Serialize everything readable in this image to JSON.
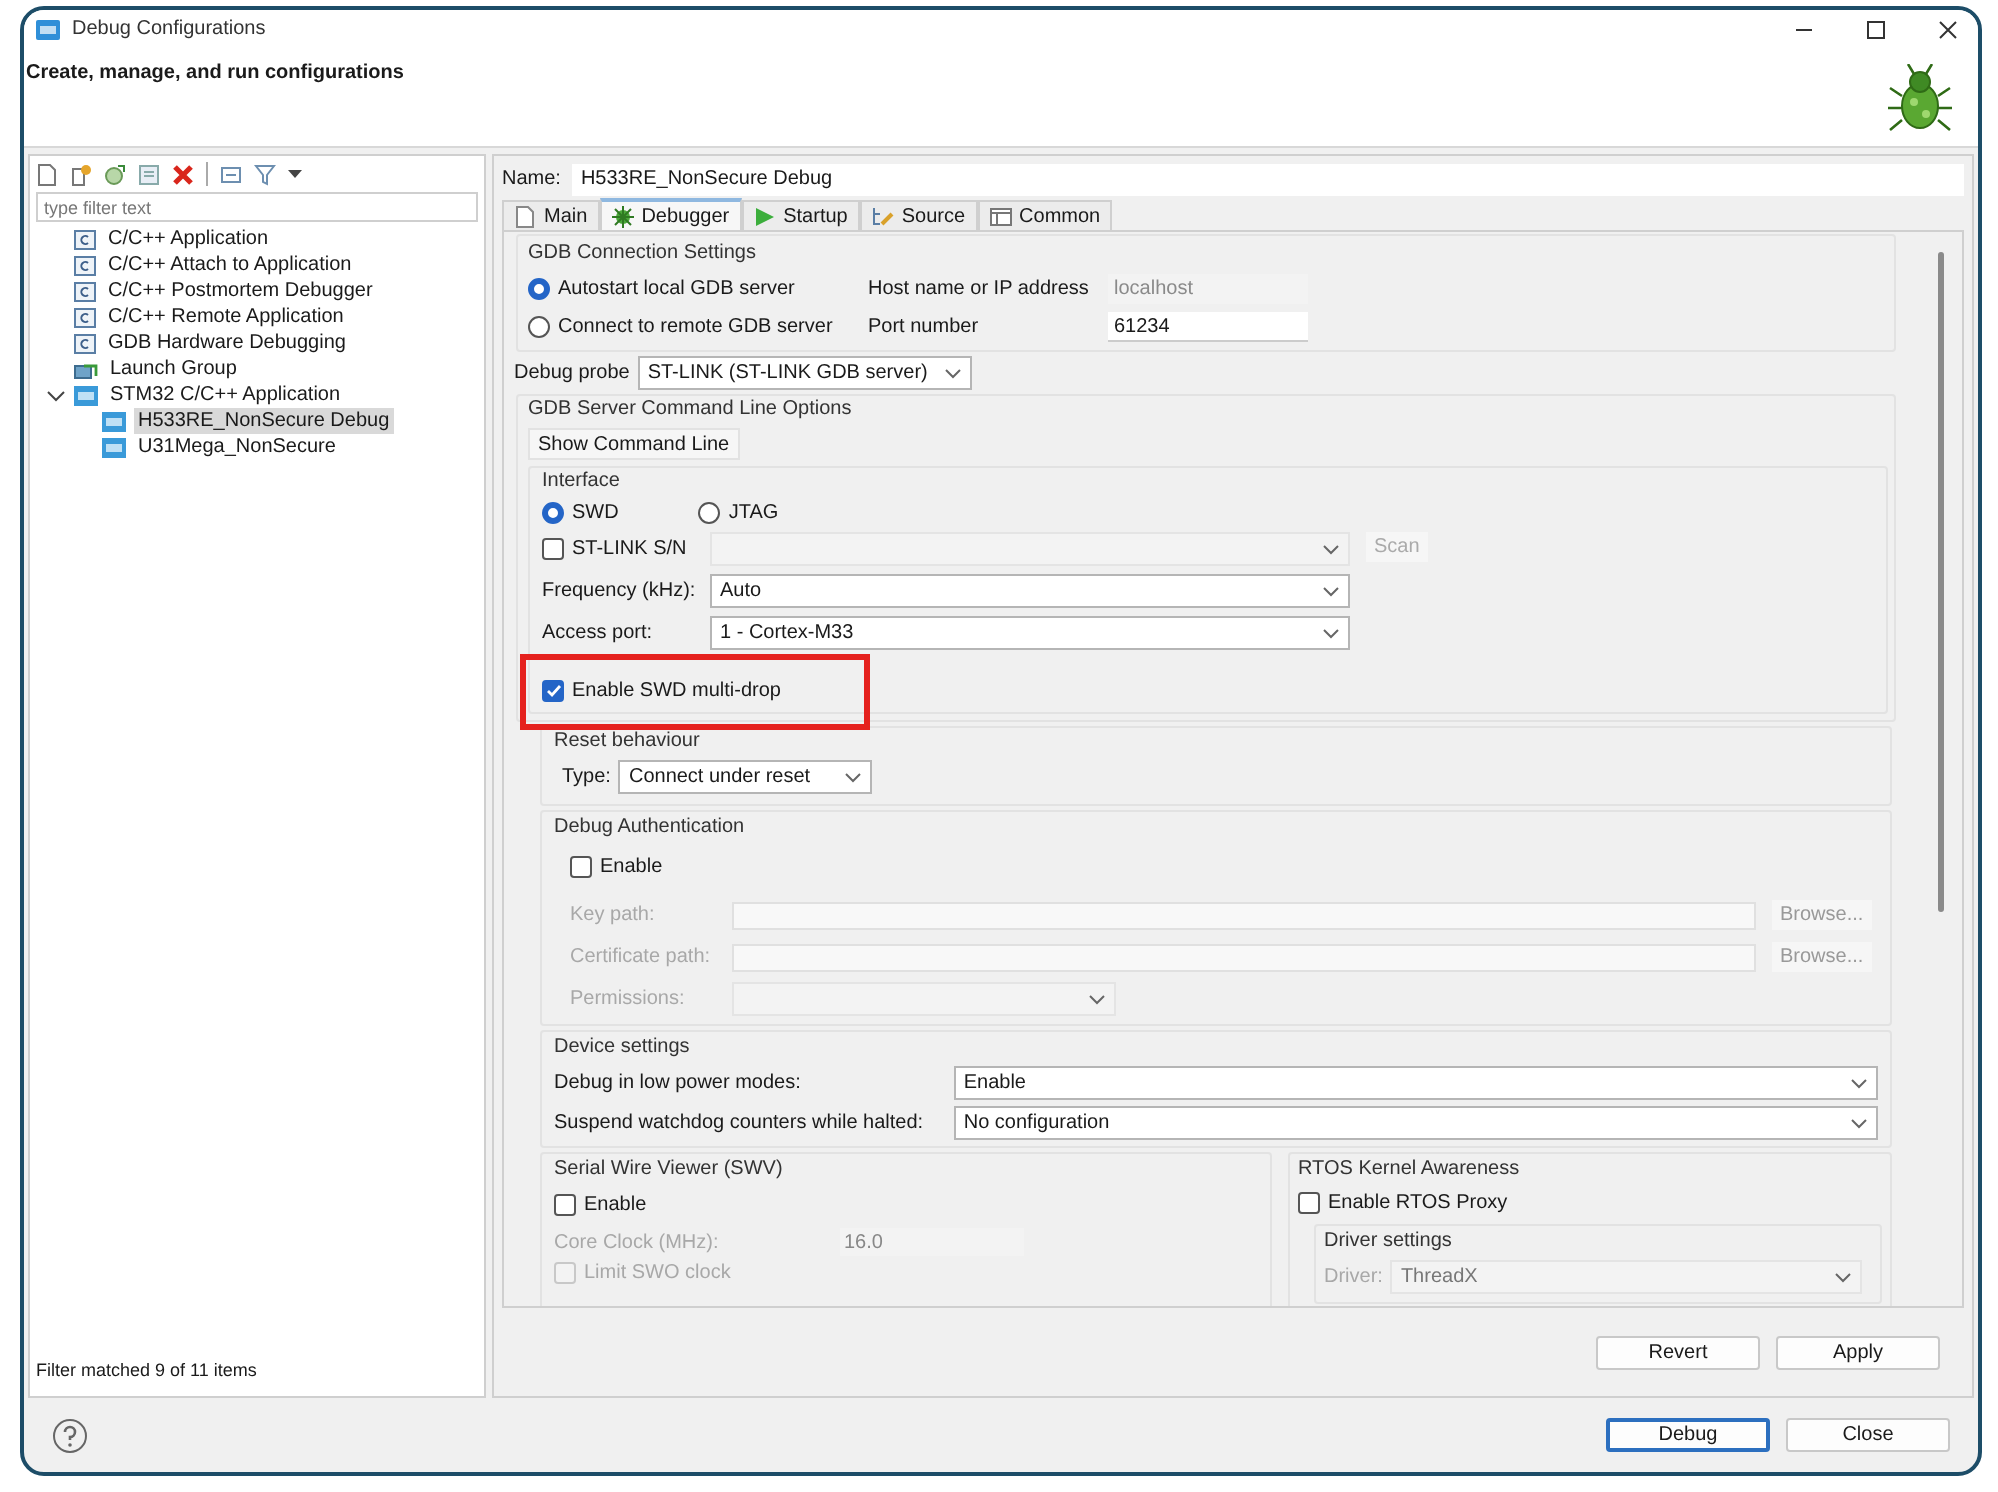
{
  "window": {
    "title": "Debug Configurations"
  },
  "header": {
    "title": "Create, manage, and run configurations"
  },
  "sidebar": {
    "filter": {
      "placeholder": "type filter text"
    },
    "tree": [
      {
        "label": "C/C++ Application",
        "kind": "c",
        "selected": false
      },
      {
        "label": "C/C++ Attach to Application",
        "kind": "c",
        "selected": false
      },
      {
        "label": "C/C++ Postmortem Debugger",
        "kind": "c",
        "selected": false
      },
      {
        "label": "C/C++ Remote Application",
        "kind": "c",
        "selected": false
      },
      {
        "label": "GDB Hardware Debugging",
        "kind": "c",
        "selected": false
      },
      {
        "label": "Launch Group",
        "kind": "launch",
        "selected": false
      },
      {
        "label": "STM32 C/C++ Application",
        "kind": "ide",
        "selected": false,
        "expanded": true,
        "children": [
          {
            "label": "H533RE_NonSecure Debug",
            "kind": "ide",
            "selected": true
          },
          {
            "label": "U31Mega_NonSecure",
            "kind": "ide",
            "selected": false
          }
        ]
      }
    ],
    "status": "Filter matched 9 of 11 items"
  },
  "editor": {
    "name_label": "Name:",
    "name_value": "H533RE_NonSecure Debug",
    "tabs": [
      {
        "label": "Main",
        "kind": "main",
        "selected": false
      },
      {
        "label": "Debugger",
        "kind": "debugger",
        "selected": true
      },
      {
        "label": "Startup",
        "kind": "startup",
        "selected": false
      },
      {
        "label": "Source",
        "kind": "source",
        "selected": false
      },
      {
        "label": "Common",
        "kind": "common",
        "selected": false
      }
    ],
    "gdb_connection": {
      "title": "GDB Connection Settings",
      "options": [
        {
          "label": "Autostart local GDB server",
          "selected": true
        },
        {
          "label": "Connect to remote GDB server",
          "selected": false
        }
      ],
      "host": {
        "label": "Host name or IP address",
        "value": "localhost",
        "disabled": true
      },
      "port": {
        "label": "Port number",
        "value": "61234",
        "disabled": false
      }
    },
    "debug_probe": {
      "label": "Debug probe",
      "value": "ST-LINK (ST-LINK GDB server)"
    },
    "server_options": {
      "title": "GDB Server Command Line Options",
      "show_command_line": "Show Command Line",
      "interface": {
        "title": "Interface",
        "options": [
          {
            "label": "SWD",
            "selected": true
          },
          {
            "label": "JTAG",
            "selected": false
          }
        ],
        "stlink_sn": {
          "label": "ST-LINK S/N",
          "checked": false
        },
        "scan": "Scan",
        "frequency": {
          "label": "Frequency (kHz):",
          "value": "Auto"
        },
        "access_port": {
          "label": "Access port:",
          "value": "1 - Cortex-M33"
        },
        "multidrop": {
          "label": "Enable SWD multi-drop",
          "checked": true,
          "highlighted": true
        }
      }
    },
    "reset": {
      "title": "Reset behaviour",
      "type_label": "Type:",
      "value": "Connect under reset"
    },
    "debug_auth": {
      "title": "Debug Authentication",
      "enable": {
        "label": "Enable",
        "checked": false
      },
      "fields": [
        {
          "label": "Key path:",
          "kind": "path",
          "button": "Browse...",
          "disabled": true
        },
        {
          "label": "Certificate path:",
          "kind": "path",
          "button": "Browse...",
          "disabled": true
        },
        {
          "label": "Permissions:",
          "kind": "select",
          "disabled": true
        }
      ]
    },
    "device_settings": {
      "title": "Device settings",
      "rows": [
        {
          "label": "Debug in low power modes:",
          "value": "Enable"
        },
        {
          "label": "Suspend watchdog counters while halted:",
          "value": "No configuration"
        }
      ]
    },
    "swv": {
      "title": "Serial Wire Viewer (SWV)",
      "enable": {
        "label": "Enable",
        "checked": false
      },
      "core_clock": {
        "label": "Core Clock (MHz):",
        "value": "16.0",
        "disabled": true
      },
      "limit": {
        "label": "Limit SWO clock",
        "checked": false,
        "disabled": true
      }
    },
    "rtos": {
      "title": "RTOS Kernel Awareness",
      "enable": {
        "label": "Enable RTOS Proxy",
        "checked": false
      },
      "driver_settings": {
        "title": "Driver settings",
        "driver": {
          "label": "Driver:",
          "value": "ThreadX",
          "disabled": true
        }
      }
    },
    "buttons": [
      "Revert",
      "Apply"
    ]
  },
  "footer": {
    "buttons": [
      {
        "label": "Debug",
        "default": true
      },
      {
        "label": "Close",
        "default": false
      }
    ]
  }
}
